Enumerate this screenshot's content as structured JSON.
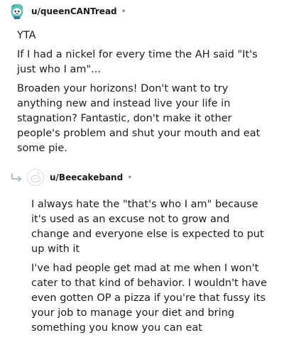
{
  "comments": [
    {
      "username": "u/queenCANTread",
      "separator": "•",
      "avatar_icon": "teal-snoo-avatar-icon",
      "paragraphs": [
        "YTA",
        "If I had a nickel for every time the AH said \"It's just who I am\"...",
        "Broaden your horizons! Don't want to try anything new and instead live your life in stagnation? Fantastic, don't make it other people's problem and shut your mouth and eat some pie."
      ]
    },
    {
      "username": "u/Beecakeband",
      "separator": "•",
      "avatar_icon": "default-snoo-avatar-icon",
      "reply_icon": "reply-arrow-icon",
      "paragraphs": [
        "I always hate the \"that's who I am\" because it's used as an excuse not to grow and change and everyone else is expected to put up with it",
        "I've had people get mad at me when I won't cater to that kind of behavior. I wouldn't have even gotten OP a pizza if you're that fussy its your job to manage your diet and bring something you know you can eat"
      ]
    }
  ],
  "colors": {
    "text": "#1c1c1c",
    "meta": "#878a8c",
    "avatar_teal": "#5fc0b4",
    "reply_arrow": "#a5b8c7"
  }
}
